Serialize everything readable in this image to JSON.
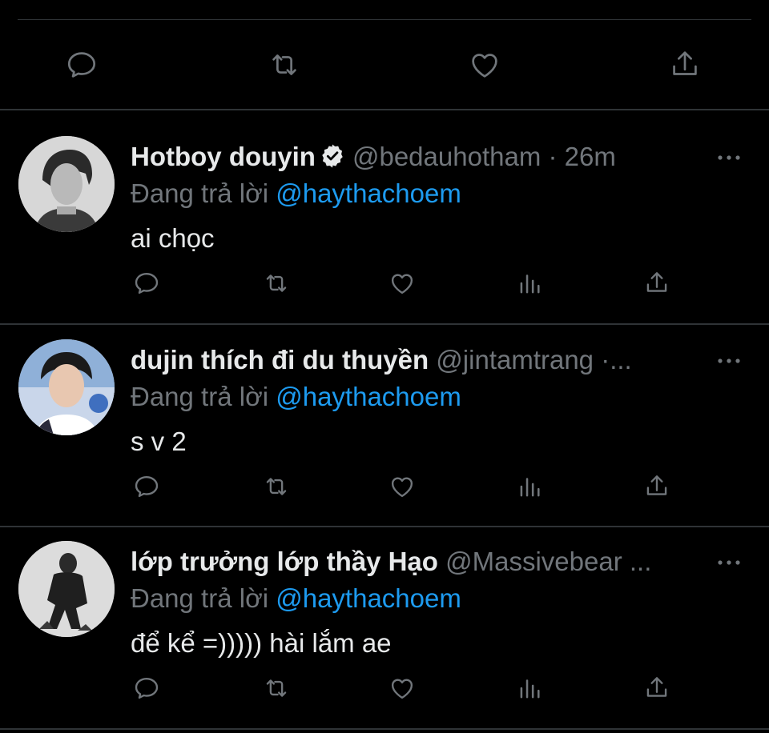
{
  "colors": {
    "background": "#000000",
    "text": "#e7e9ea",
    "muted": "#71767b",
    "link": "#1d9bf0",
    "divider": "#2f3336"
  },
  "top_actions": [
    "reply-icon",
    "retweet-icon",
    "like-icon",
    "share-icon"
  ],
  "tweets": [
    {
      "name": "Hotboy douyin",
      "verified": true,
      "handle_meta": "@bedauhotham · 26m",
      "reply_prefix": "Đang trả lời",
      "reply_mention": "@haythachoem",
      "text": "ai chọc",
      "actions": [
        "reply-icon",
        "retweet-icon",
        "like-icon",
        "analytics-icon",
        "share-icon"
      ]
    },
    {
      "name": "dujin thích đi du thuyền",
      "verified": false,
      "handle_meta": "@jintamtrang ·...",
      "reply_prefix": "Đang trả lời",
      "reply_mention": "@haythachoem",
      "text": "s v 2",
      "actions": [
        "reply-icon",
        "retweet-icon",
        "like-icon",
        "analytics-icon",
        "share-icon"
      ]
    },
    {
      "name": "lớp trưởng lớp thầy Hạo",
      "verified": false,
      "handle_meta": "@Massivebear ...",
      "reply_prefix": "Đang trả lời",
      "reply_mention": "@haythachoem",
      "text": "để kể =))))) hài lắm ae",
      "actions": [
        "reply-icon",
        "retweet-icon",
        "like-icon",
        "analytics-icon",
        "share-icon"
      ]
    }
  ]
}
